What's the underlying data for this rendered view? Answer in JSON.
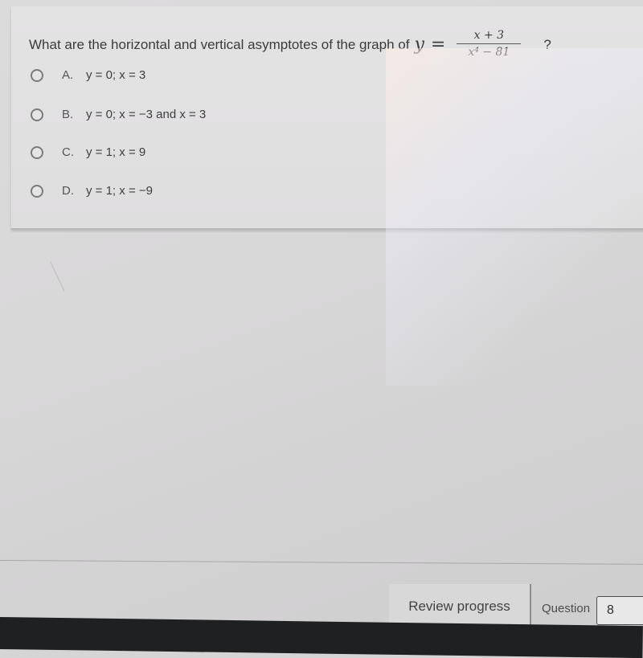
{
  "question": {
    "prefix": "What are the horizontal and vertical asymptotes of the graph of",
    "math_var": "y",
    "equals": "=",
    "numerator": "x + 3",
    "denominator": "x⁴ − 81",
    "suffix": "?"
  },
  "options": [
    {
      "letter": "A.",
      "text": "y = 0; x = 3",
      "selected": false
    },
    {
      "letter": "B.",
      "text": "y = 0; x = −3 and x = 3",
      "selected": false
    },
    {
      "letter": "C.",
      "text": "y = 1; x = 9",
      "selected": false
    },
    {
      "letter": "D.",
      "text": "y = 1; x = −9",
      "selected": false
    }
  ],
  "footer": {
    "review_label": "Review progress",
    "question_label": "Question",
    "question_number": "8"
  }
}
